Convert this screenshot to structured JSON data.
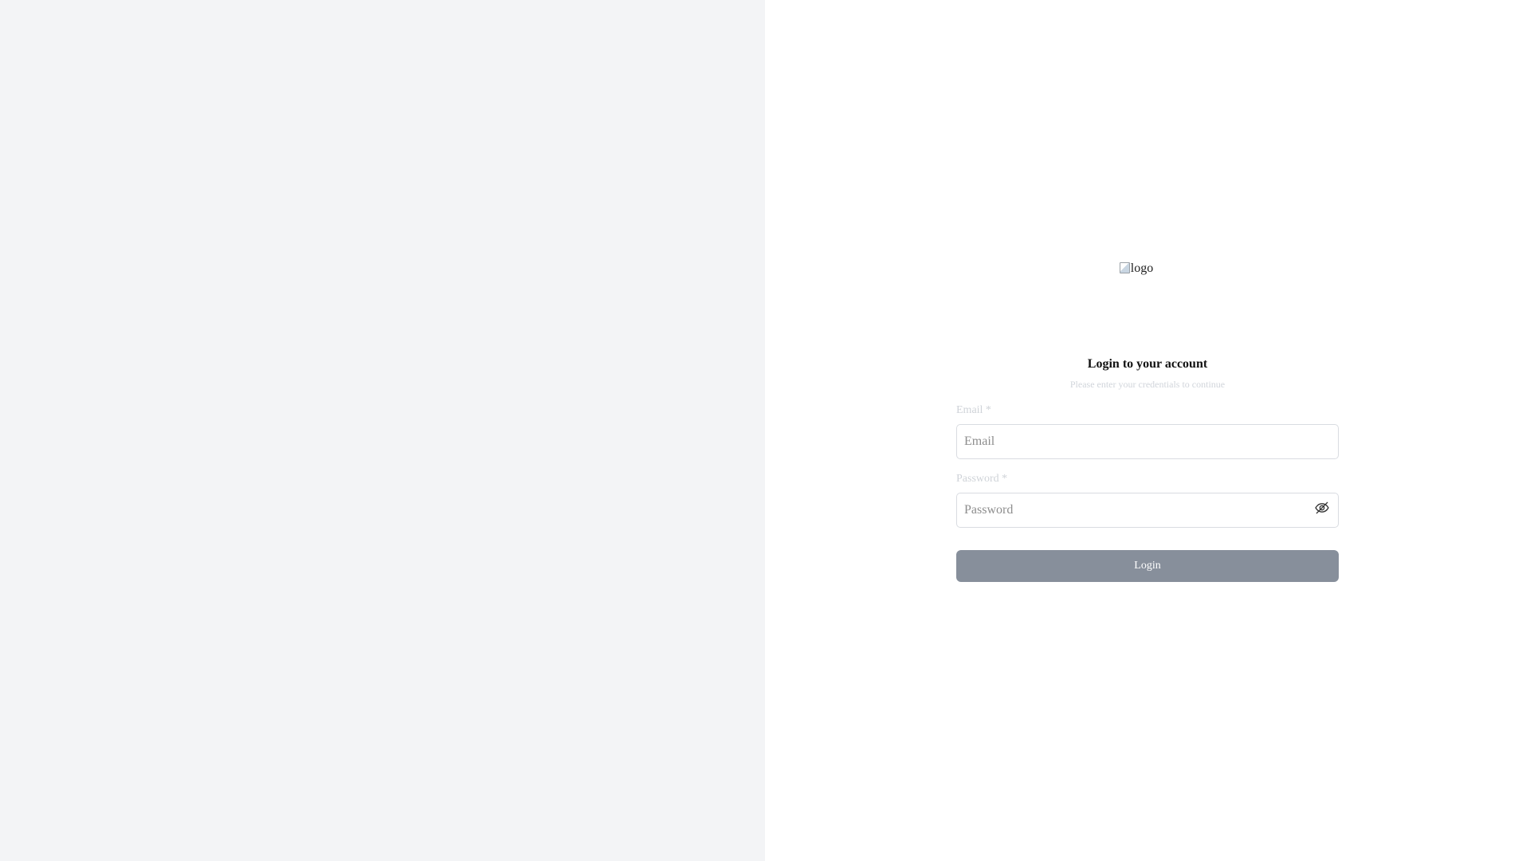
{
  "logo": {
    "alt_text": "logo"
  },
  "login": {
    "title": "Login to your account",
    "subtitle": "Please enter your credentials to continue"
  },
  "form": {
    "email": {
      "label": "Email *",
      "placeholder": "Email",
      "value": ""
    },
    "password": {
      "label": "Password *",
      "placeholder": "Password",
      "value": "",
      "toggle_icon": "eye-off-icon"
    },
    "submit_label": "Login"
  },
  "colors": {
    "left_panel_bg": "#f3f4f6",
    "button_bg": "#878f9b",
    "label_color": "#cfd3d8"
  }
}
